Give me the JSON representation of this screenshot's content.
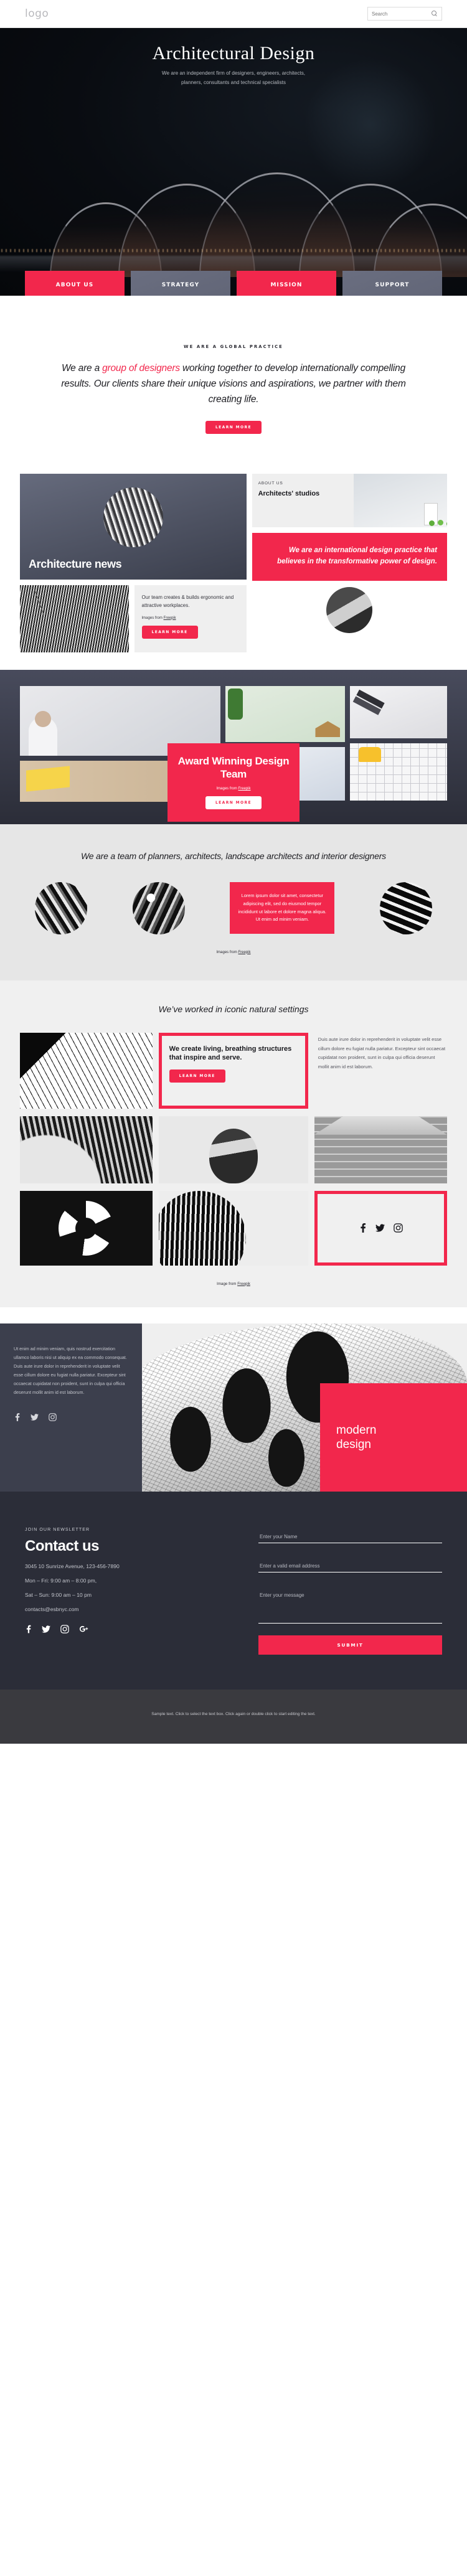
{
  "topbar": {
    "logo": "logo",
    "search_placeholder": "Search",
    "search_value": ""
  },
  "hero": {
    "title": "Architectural Design",
    "subtitle_line1": "We are an independent firm of designers, engineers, architects,",
    "subtitle_line2": "planners, consultants and technical specialists"
  },
  "nav_cards": [
    {
      "label": "ABOUT US",
      "icon": "buildings-icon",
      "style": "pink"
    },
    {
      "label": "STRATEGY",
      "icon": "chess-knight-icon",
      "style": "gray"
    },
    {
      "label": "MISSION",
      "icon": "house-icon",
      "style": "pink"
    },
    {
      "label": "SUPPORT",
      "icon": "life-ring-icon",
      "style": "gray"
    }
  ],
  "practice": {
    "eyebrow": "WE ARE A GLOBAL PRACTICE",
    "lead_1": "We are a ",
    "highlight": "group of designers",
    "lead_2": " working together to develop internationally compelling results. Our clients share their unique visions and aspirations, we partner with them creating life.",
    "button": "LEARN MORE"
  },
  "news": {
    "headline": "Architecture news",
    "note_text": "Our team creates & builds ergonomic and attractive workplaces.",
    "note_credit_prefix": "Images from ",
    "note_credit_link": "Freepik",
    "note_button": "LEARN MORE",
    "about_eyebrow": "ABOUT US",
    "about_title": "Architects' studios",
    "quote": "We are an international design practice that believes in the transformative power of design."
  },
  "award": {
    "title": "Award Winning Design Team",
    "credit_prefix": "Images from ",
    "credit_link": "Freepik",
    "button": "LEARN MORE"
  },
  "team": {
    "heading": "We are a team of planners, architects, landscape architects and interior designers",
    "pink_text": "Lorem ipsum dolor sit amet, consectetur adipiscing elit, sed do eiusmod tempor incididunt ut labore et dolore magna aliqua. Ut enim ad minim veniam.",
    "credit_prefix": "Images from ",
    "credit_link": "Freepik"
  },
  "iconic": {
    "heading": "We’ve worked in iconic natural settings",
    "card_title": "We create living, breathing structures that inspire and serve.",
    "card_button": "LEARN MORE",
    "paragraph": "Duis aute irure dolor in reprehenderit in voluptate velit esse cillum dolore eu fugiat nulla pariatur. Excepteur sint occaecat cupidatat non proident, sunt in culpa qui officia deserunt mollit anim id est laborum.",
    "social": [
      "facebook-icon",
      "twitter-icon",
      "instagram-icon"
    ],
    "credit_prefix": "Image from ",
    "credit_link": "Freepik"
  },
  "modern": {
    "paragraph": "Ut enim ad minim veniam, quis nostrud exercitation ullamco laboris nisi ut aliquip ex ea commodo consequat. Duis aute irure dolor in reprehenderit in voluptate velit esse cillum dolore eu fugiat nulla pariatur. Excepteur sint occaecat cupidatat non proident, sunt in culpa qui officia deserunt mollit anim id est laborum.",
    "label_line1": "modern",
    "label_line2": "design",
    "social": [
      "facebook-icon",
      "twitter-icon",
      "instagram-icon"
    ]
  },
  "contact": {
    "eyebrow": "JOIN OUR NEWSLETTER",
    "title": "Contact us",
    "address": "3045 10 Sunrize Avenue, 123-456-7890",
    "hours_weekday": "Mon – Fri: 9:00 am – 8:00 pm,",
    "hours_weekend": "Sat – Sun: 9:00 am – 10 pm",
    "email": "contacts@esbnyc.com",
    "social": [
      "facebook-icon",
      "twitter-icon",
      "instagram-icon",
      "google-plus-icon"
    ],
    "name_placeholder": "Enter your Name",
    "name_value": "",
    "email_placeholder": "Enter a valid email address",
    "email_value": "",
    "message_placeholder": "Enter your message",
    "message_value": "",
    "submit_label": "SUBMIT"
  },
  "footer": {
    "text": "Sample text. Click to select the text box. Click again or double click to start editing the text."
  },
  "colors": {
    "accent": "#f2274c",
    "dark": "#2b2d38",
    "slate": "#5b5f70"
  }
}
